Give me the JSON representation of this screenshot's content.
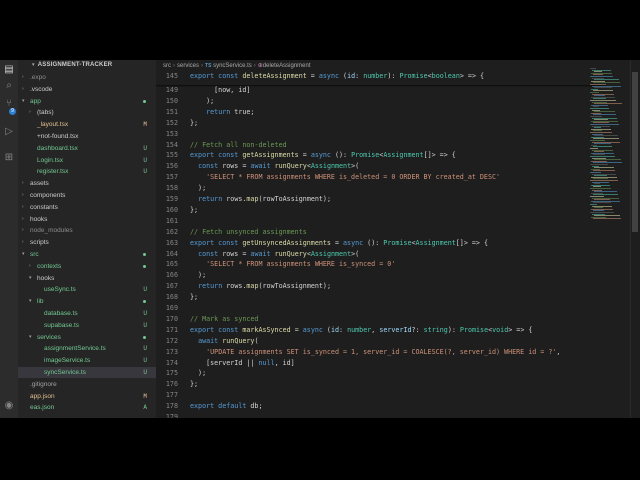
{
  "activity_bar": {
    "icons": [
      "files-icon",
      "search-icon",
      "source-control-icon",
      "run-debug-icon",
      "extensions-icon",
      "account-icon"
    ],
    "badge": "9"
  },
  "explorer": {
    "title": "ASSIGNMENT-TRACKER",
    "items": [
      {
        "label": ".expo",
        "kind": "folder",
        "open": false,
        "depth": 1,
        "status": "",
        "color": "#8c8c8c"
      },
      {
        "label": ".vscode",
        "kind": "folder",
        "open": false,
        "depth": 1,
        "status": "",
        "color": "#cccccc"
      },
      {
        "label": "app",
        "kind": "folder",
        "open": true,
        "depth": 1,
        "status": "dot",
        "color": "#73c991"
      },
      {
        "label": "(tabs)",
        "kind": "folder",
        "open": false,
        "depth": 2,
        "status": "",
        "color": "#cccccc"
      },
      {
        "label": "_layout.tsx",
        "kind": "file",
        "depth": 2,
        "status": "M",
        "color": "#e2c08d"
      },
      {
        "label": "+not-found.tsx",
        "kind": "file",
        "depth": 2,
        "status": "",
        "color": "#cccccc"
      },
      {
        "label": "dashboard.tsx",
        "kind": "file",
        "depth": 2,
        "status": "U",
        "color": "#73c991"
      },
      {
        "label": "Login.tsx",
        "kind": "file",
        "depth": 2,
        "status": "U",
        "color": "#73c991"
      },
      {
        "label": "register.tsx",
        "kind": "file",
        "depth": 2,
        "status": "U",
        "color": "#73c991"
      },
      {
        "label": "assets",
        "kind": "folder",
        "open": false,
        "depth": 1,
        "status": "",
        "color": "#cccccc"
      },
      {
        "label": "components",
        "kind": "folder",
        "open": false,
        "depth": 1,
        "status": "",
        "color": "#cccccc"
      },
      {
        "label": "constants",
        "kind": "folder",
        "open": false,
        "depth": 1,
        "status": "",
        "color": "#cccccc"
      },
      {
        "label": "hooks",
        "kind": "folder",
        "open": false,
        "depth": 1,
        "status": "",
        "color": "#cccccc"
      },
      {
        "label": "node_modules",
        "kind": "folder",
        "open": false,
        "depth": 1,
        "status": "",
        "color": "#8c8c8c"
      },
      {
        "label": "scripts",
        "kind": "folder",
        "open": false,
        "depth": 1,
        "status": "",
        "color": "#cccccc"
      },
      {
        "label": "src",
        "kind": "folder",
        "open": true,
        "depth": 1,
        "status": "dot",
        "color": "#73c991"
      },
      {
        "label": "contexts",
        "kind": "folder",
        "open": false,
        "depth": 2,
        "status": "dot",
        "color": "#73c991"
      },
      {
        "label": "hooks",
        "kind": "folder",
        "open": true,
        "depth": 2,
        "status": "",
        "color": "#cccccc"
      },
      {
        "label": "useSync.ts",
        "kind": "file",
        "depth": 3,
        "status": "U",
        "color": "#73c991"
      },
      {
        "label": "lib",
        "kind": "folder",
        "open": true,
        "depth": 2,
        "status": "dot",
        "color": "#73c991"
      },
      {
        "label": "database.ts",
        "kind": "file",
        "depth": 3,
        "status": "U",
        "color": "#73c991"
      },
      {
        "label": "supabase.ts",
        "kind": "file",
        "depth": 3,
        "status": "U",
        "color": "#73c991"
      },
      {
        "label": "services",
        "kind": "folder",
        "open": true,
        "depth": 2,
        "status": "dot",
        "color": "#73c991"
      },
      {
        "label": "assignmentService.ts",
        "kind": "file",
        "depth": 3,
        "status": "U",
        "color": "#73c991"
      },
      {
        "label": "imageService.ts",
        "kind": "file",
        "depth": 3,
        "status": "U",
        "color": "#73c991"
      },
      {
        "label": "syncService.ts",
        "kind": "file",
        "depth": 3,
        "status": "U",
        "color": "#73c991",
        "selected": true
      },
      {
        "label": ".gitignore",
        "kind": "file",
        "depth": 1,
        "status": "",
        "color": "#a0a0a0"
      },
      {
        "label": "app.json",
        "kind": "file",
        "depth": 1,
        "status": "M",
        "color": "#e2c08d"
      },
      {
        "label": "eas.json",
        "kind": "file",
        "depth": 1,
        "status": "A",
        "color": "#73c991"
      }
    ]
  },
  "breadcrumb": {
    "parts": [
      "src",
      "services"
    ],
    "file_badge": "TS",
    "file": "syncService.ts",
    "symbol_badge": "⊕",
    "symbol": "deleteAssignment"
  },
  "sticky_line": {
    "number": "145",
    "tokens": [
      [
        "export const ",
        "k"
      ],
      [
        "deleteAssignment",
        "f"
      ],
      [
        " = ",
        ""
      ],
      [
        "async",
        "k"
      ],
      [
        " (",
        ""
      ],
      [
        "id",
        "v"
      ],
      [
        ": ",
        ""
      ],
      [
        "number",
        "t"
      ],
      [
        "): ",
        ""
      ],
      [
        "Promise",
        "t"
      ],
      [
        "<",
        ""
      ],
      [
        "boolean",
        "t"
      ],
      [
        "> => {",
        ""
      ]
    ]
  },
  "code_lines": [
    {
      "n": "149",
      "tokens": [
        [
          "      [now, id]",
          ""
        ]
      ]
    },
    {
      "n": "150",
      "tokens": [
        [
          "    );",
          ""
        ]
      ]
    },
    {
      "n": "151",
      "tokens": [
        [
          "    ",
          ""
        ],
        [
          "return",
          "k"
        ],
        [
          " true;",
          ""
        ]
      ]
    },
    {
      "n": "152",
      "tokens": [
        [
          "};",
          ""
        ]
      ]
    },
    {
      "n": "153",
      "tokens": [
        [
          "",
          ""
        ]
      ]
    },
    {
      "n": "154",
      "tokens": [
        [
          "// Fetch all non-deleted",
          "c"
        ]
      ]
    },
    {
      "n": "155",
      "tokens": [
        [
          "export const ",
          "k"
        ],
        [
          "getAssignments",
          "f"
        ],
        [
          " = ",
          ""
        ],
        [
          "async",
          "k"
        ],
        [
          " (): ",
          ""
        ],
        [
          "Promise",
          "t"
        ],
        [
          "<",
          ""
        ],
        [
          "Assignment",
          "t"
        ],
        [
          "[]> => {",
          ""
        ]
      ]
    },
    {
      "n": "156",
      "tokens": [
        [
          "  ",
          ""
        ],
        [
          "const",
          "k"
        ],
        [
          " rows = ",
          ""
        ],
        [
          "await",
          "k"
        ],
        [
          " ",
          ""
        ],
        [
          "runQuery",
          "f"
        ],
        [
          "<",
          ""
        ],
        [
          "Assignment",
          "t"
        ],
        [
          ">(",
          ""
        ]
      ]
    },
    {
      "n": "157",
      "tokens": [
        [
          "    ",
          ""
        ],
        [
          "'SELECT * FROM assignments WHERE is_deleted = 0 ORDER BY created_at DESC'",
          "s"
        ]
      ]
    },
    {
      "n": "158",
      "tokens": [
        [
          "  );",
          ""
        ]
      ]
    },
    {
      "n": "159",
      "tokens": [
        [
          "  ",
          ""
        ],
        [
          "return",
          "k"
        ],
        [
          " rows.",
          ""
        ],
        [
          "map",
          "f"
        ],
        [
          "(rowToAssignment);",
          ""
        ]
      ]
    },
    {
      "n": "160",
      "tokens": [
        [
          "};",
          ""
        ]
      ]
    },
    {
      "n": "161",
      "tokens": [
        [
          "",
          ""
        ]
      ]
    },
    {
      "n": "162",
      "tokens": [
        [
          "// Fetch unsynced assignments",
          "c"
        ]
      ]
    },
    {
      "n": "163",
      "tokens": [
        [
          "export const ",
          "k"
        ],
        [
          "getUnsyncedAssignments",
          "f"
        ],
        [
          " = ",
          ""
        ],
        [
          "async",
          "k"
        ],
        [
          " (): ",
          ""
        ],
        [
          "Promise",
          "t"
        ],
        [
          "<",
          ""
        ],
        [
          "Assignment",
          "t"
        ],
        [
          "[]> => {",
          ""
        ]
      ]
    },
    {
      "n": "164",
      "tokens": [
        [
          "  ",
          ""
        ],
        [
          "const",
          "k"
        ],
        [
          " rows = ",
          ""
        ],
        [
          "await",
          "k"
        ],
        [
          " ",
          ""
        ],
        [
          "runQuery",
          "f"
        ],
        [
          "<",
          ""
        ],
        [
          "Assignment",
          "t"
        ],
        [
          ">(",
          ""
        ]
      ]
    },
    {
      "n": "165",
      "tokens": [
        [
          "    ",
          ""
        ],
        [
          "'SELECT * FROM assignments WHERE is_synced = 0'",
          "s"
        ]
      ]
    },
    {
      "n": "166",
      "tokens": [
        [
          "  );",
          ""
        ]
      ]
    },
    {
      "n": "167",
      "tokens": [
        [
          "  ",
          ""
        ],
        [
          "return",
          "k"
        ],
        [
          " rows.",
          ""
        ],
        [
          "map",
          "f"
        ],
        [
          "(rowToAssignment);",
          ""
        ]
      ]
    },
    {
      "n": "168",
      "tokens": [
        [
          "};",
          ""
        ]
      ]
    },
    {
      "n": "169",
      "tokens": [
        [
          "",
          ""
        ]
      ]
    },
    {
      "n": "170",
      "tokens": [
        [
          "// Mark as synced",
          "c"
        ]
      ]
    },
    {
      "n": "171",
      "tokens": [
        [
          "export const ",
          "k"
        ],
        [
          "markAsSynced",
          "f"
        ],
        [
          " = ",
          ""
        ],
        [
          "async",
          "k"
        ],
        [
          " (",
          ""
        ],
        [
          "id",
          "v"
        ],
        [
          ": ",
          ""
        ],
        [
          "number",
          "t"
        ],
        [
          ", ",
          ""
        ],
        [
          "serverId",
          "v"
        ],
        [
          "?: ",
          ""
        ],
        [
          "string",
          "t"
        ],
        [
          "): ",
          ""
        ],
        [
          "Promise",
          "t"
        ],
        [
          "<",
          ""
        ],
        [
          "void",
          "t"
        ],
        [
          "> => {",
          ""
        ]
      ]
    },
    {
      "n": "172",
      "tokens": [
        [
          "  ",
          ""
        ],
        [
          "await",
          "k"
        ],
        [
          " ",
          ""
        ],
        [
          "runQuery",
          "f"
        ],
        [
          "(",
          ""
        ]
      ]
    },
    {
      "n": "173",
      "tokens": [
        [
          "    ",
          ""
        ],
        [
          "'UPDATE assignments SET is_synced = 1, server_id = COALESCE(?, server_id) WHERE id = ?'",
          "s"
        ],
        [
          ",",
          ""
        ]
      ]
    },
    {
      "n": "174",
      "tokens": [
        [
          "    [serverId || ",
          ""
        ],
        [
          "null",
          "k"
        ],
        [
          ", id]",
          ""
        ]
      ]
    },
    {
      "n": "175",
      "tokens": [
        [
          "  );",
          ""
        ]
      ]
    },
    {
      "n": "176",
      "tokens": [
        [
          "};",
          ""
        ]
      ]
    },
    {
      "n": "177",
      "tokens": [
        [
          "",
          ""
        ]
      ]
    },
    {
      "n": "178",
      "tokens": [
        [
          "export default ",
          "k"
        ],
        [
          "db;",
          ""
        ]
      ]
    },
    {
      "n": "179",
      "tokens": [
        [
          "",
          ""
        ]
      ]
    }
  ]
}
